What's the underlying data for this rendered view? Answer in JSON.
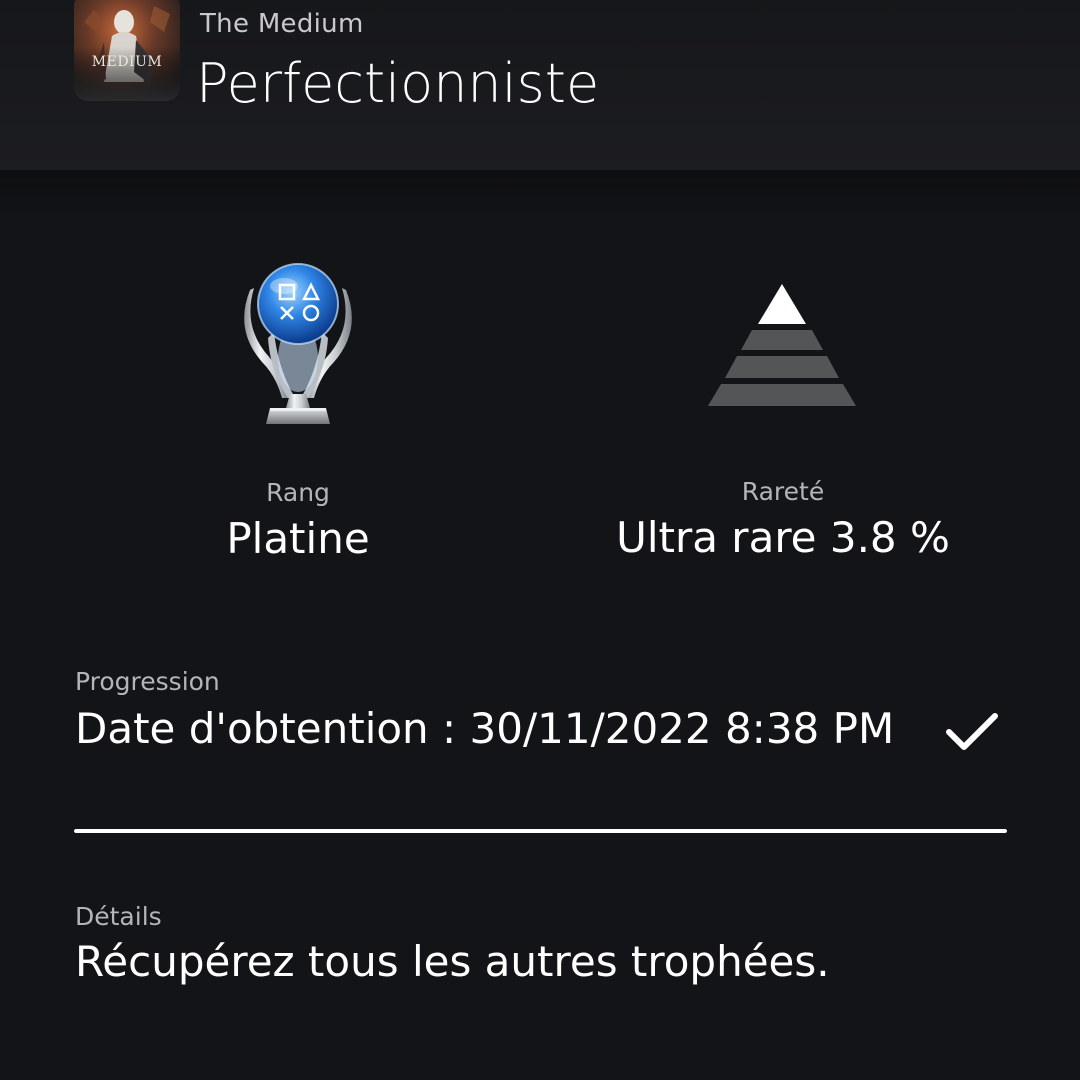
{
  "header": {
    "game_title": "The Medium",
    "game_art_text": "MEDIUM",
    "trophy_title": "Perfectionniste"
  },
  "stats": {
    "rank": {
      "label": "Rang",
      "value": "Platine",
      "icon": "platinum-trophy-icon"
    },
    "rarity": {
      "label": "Rareté",
      "value": "Ultra rare 3.8 %",
      "icon": "rarity-pyramid-icon"
    }
  },
  "progress": {
    "label": "Progression",
    "text": "Date d'obtention : 30/11/2022  8:38 PM",
    "percent": 100,
    "status_icon": "checkmark-icon"
  },
  "details": {
    "label": "Détails",
    "text": "Récupérez tous les autres trophées."
  },
  "colors": {
    "background": "#131417",
    "header": "#1c1d20",
    "text_primary": "#ffffff",
    "text_secondary": "#b4b5b9",
    "pyramid_top": "#ffffff",
    "pyramid_levels": "#545557"
  }
}
